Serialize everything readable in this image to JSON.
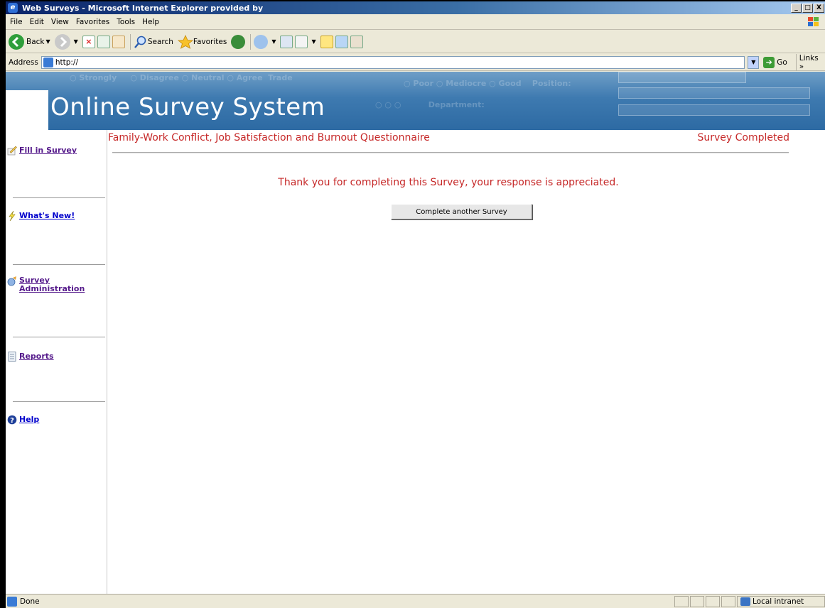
{
  "window": {
    "title": "Web Surveys - Microsoft Internet Explorer provided by",
    "minimize": "_",
    "restore": "□",
    "close": "X"
  },
  "menu": [
    "File",
    "Edit",
    "View",
    "Favorites",
    "Tools",
    "Help"
  ],
  "toolbar": {
    "back_label": "Back",
    "search_label": "Search",
    "favorites_label": "Favorites"
  },
  "address": {
    "label": "Address",
    "url": "http://",
    "go_label": "Go",
    "links_label": "Links »"
  },
  "banner": {
    "brand": "Online Survey System"
  },
  "sidebar": {
    "items": [
      {
        "label": "Fill in Survey",
        "icon": "pencil-icon"
      },
      {
        "label": "What's New!",
        "icon": "lightning-icon"
      },
      {
        "label": "Survey Administration",
        "icon": "admin-icon"
      },
      {
        "label": "Reports",
        "icon": "document-icon"
      },
      {
        "label": "Help",
        "icon": "help-icon"
      }
    ]
  },
  "main": {
    "survey_title": "Family-Work Conflict, Job Satisfaction and Burnout Questionnaire",
    "status": "Survey Completed",
    "thanks": "Thank you for completing this Survey, your response is appreciated.",
    "button_label": "Complete another Survey"
  },
  "statusbar": {
    "text": "Done",
    "zone": "Local intranet"
  },
  "colors": {
    "accent_red": "#c62828",
    "link_purple": "#551a8b",
    "link_blue": "#0000cc",
    "banner_blue": "#3e7ab0"
  }
}
